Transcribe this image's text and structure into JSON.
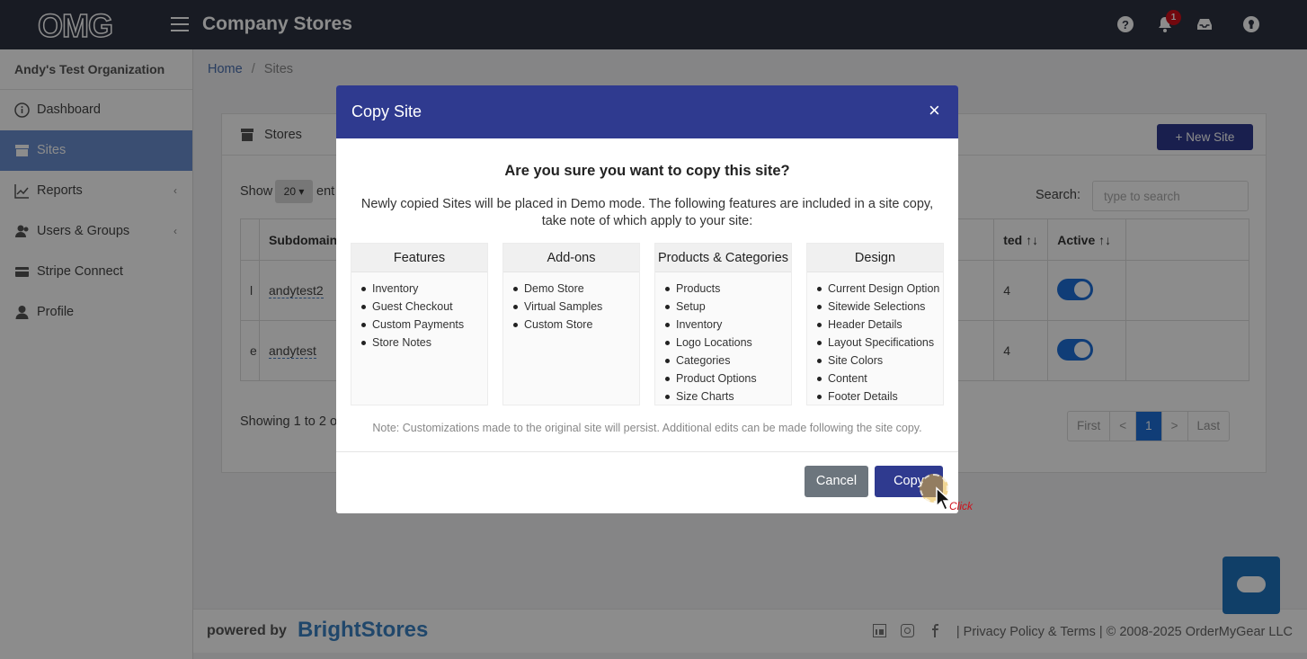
{
  "header": {
    "logo": "OMG",
    "app_title": "Company Stores",
    "notification_count": "1"
  },
  "sidebar": {
    "org_name": "Andy's Test Organization",
    "items": [
      {
        "label": "Dashboard",
        "icon": "info-circle-icon"
      },
      {
        "label": "Sites",
        "icon": "store-icon"
      },
      {
        "label": "Reports",
        "icon": "line-chart-icon"
      },
      {
        "label": "Users & Groups",
        "icon": "users-icon"
      },
      {
        "label": "Stripe Connect",
        "icon": "credit-card-icon"
      },
      {
        "label": "Profile",
        "icon": "user-icon"
      }
    ]
  },
  "breadcrumb": {
    "home": "Home",
    "separator": "/",
    "current": "Sites"
  },
  "stores_card": {
    "title": "Stores",
    "new_site_label": "+ New Site",
    "show_label": "Show",
    "show_value": "20 ▾",
    "show_entries_partial": "ent",
    "search_label": "Search:",
    "search_placeholder": "type to search",
    "columns": [
      "Subdomain",
      "ted ↑↓",
      "Active ↑↓"
    ],
    "rows": [
      {
        "prefix": "l",
        "subdomain": "andytest2",
        "num": "4"
      },
      {
        "prefix": "e",
        "subdomain": "andytest",
        "num": "4"
      }
    ],
    "showing_text": "Showing 1 to 2 o",
    "pager": [
      "First",
      "<",
      "1",
      ">",
      "Last"
    ]
  },
  "modal": {
    "title": "Copy Site",
    "close": "×",
    "question": "Are you sure you want to copy this site?",
    "description": "Newly copied Sites will be placed in Demo mode. The following features are included in a site copy, take note of which apply to your site:",
    "columns": [
      {
        "heading": "Features",
        "items": [
          "Inventory",
          "Guest Checkout",
          "Custom Payments",
          "Store Notes"
        ]
      },
      {
        "heading": "Add-ons",
        "items": [
          "Demo Store",
          "Virtual Samples",
          "Custom Store"
        ]
      },
      {
        "heading": "Products & Categories",
        "items": [
          "Products",
          "Setup",
          "Inventory",
          "Logo Locations",
          "Categories",
          "Product Options",
          "Size Charts"
        ]
      },
      {
        "heading": "Design",
        "items": [
          "Current Design Option",
          "Sitewide Selections",
          "Header Details",
          "Layout Specifications",
          "Site Colors",
          "Content",
          "Footer Details"
        ]
      }
    ],
    "note": "Note: Customizations made to the original site will persist. Additional edits can be made following the site copy.",
    "cancel_label": "Cancel",
    "copy_label": "Copy"
  },
  "cursor": {
    "click_label": "Click"
  },
  "footer": {
    "powered_by": "powered by",
    "brand": "BrightStores",
    "legal": "| Privacy Policy & Terms | © 2008-2025 OrderMyGear LLC"
  },
  "colors": {
    "topbar": "#2c3240",
    "modal_header": "#2f3a8f",
    "primary_button": "#2f3a8f",
    "secondary_button": "#6c757d",
    "toggle_on": "#1e6fd9",
    "badge": "#d0101b"
  }
}
